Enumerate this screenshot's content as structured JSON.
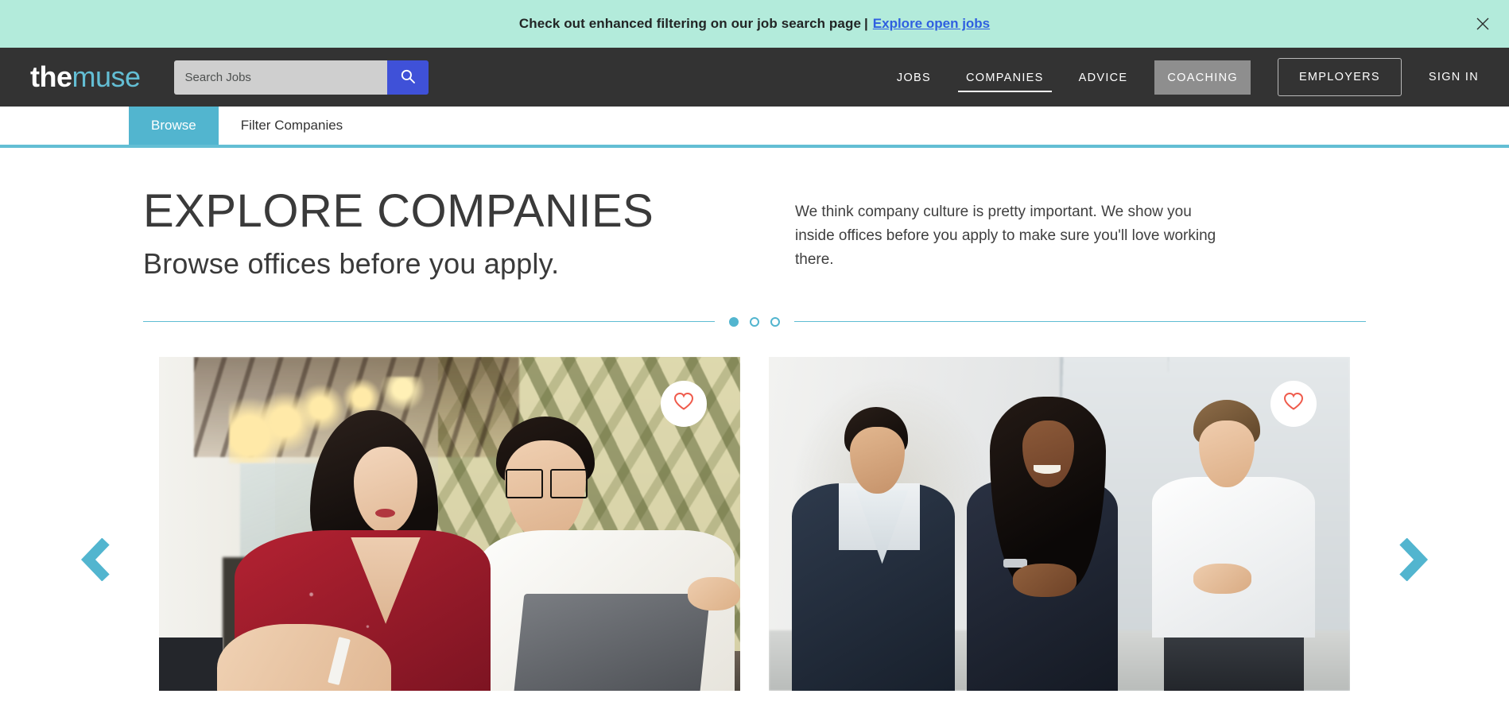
{
  "banner": {
    "text": "Check out enhanced filtering on our job search page",
    "separator": "|",
    "link_label": "Explore open jobs",
    "close_icon": "close-icon",
    "background_color": "#b3ebdb",
    "link_color": "#2f5fe0"
  },
  "header": {
    "logo": {
      "part1": "the",
      "part2": "muse"
    },
    "search": {
      "placeholder": "Search Jobs",
      "value": "",
      "icon": "search-icon",
      "button_color": "#3f51d8"
    },
    "nav": [
      {
        "label": "JOBS",
        "active": false,
        "boxed": false
      },
      {
        "label": "COMPANIES",
        "active": true,
        "boxed": false
      },
      {
        "label": "ADVICE",
        "active": false,
        "boxed": false
      },
      {
        "label": "COACHING",
        "active": false,
        "boxed": true
      }
    ],
    "employers_label": "EMPLOYERS",
    "signin_label": "SIGN IN",
    "background_color": "#333333"
  },
  "subnav": {
    "tabs": [
      {
        "label": "Browse",
        "active": true
      },
      {
        "label": "Filter Companies",
        "active": false
      }
    ],
    "active_color": "#52b5cf",
    "underline_color": "#63bed4"
  },
  "hero": {
    "title": "EXPLORE COMPANIES",
    "subtitle": "Browse offices before you apply.",
    "paragraph": "We think company culture is pretty important. We show you inside offices before you apply to make sure you'll love working there."
  },
  "carousel": {
    "dots": [
      {
        "index": 1,
        "active": true
      },
      {
        "index": 2,
        "active": false
      },
      {
        "index": 3,
        "active": false
      }
    ],
    "prev_icon": "chevron-left-icon",
    "next_icon": "chevron-right-icon",
    "arrow_color": "#52b5cf",
    "cards": [
      {
        "photo": "two-colleagues-at-laptop-photo",
        "favorite_icon": "heart-icon",
        "favorited": false
      },
      {
        "photo": "three-colleagues-talking-photo",
        "favorite_icon": "heart-icon",
        "favorited": false
      }
    ],
    "heart_color": "#ef5b4c"
  }
}
